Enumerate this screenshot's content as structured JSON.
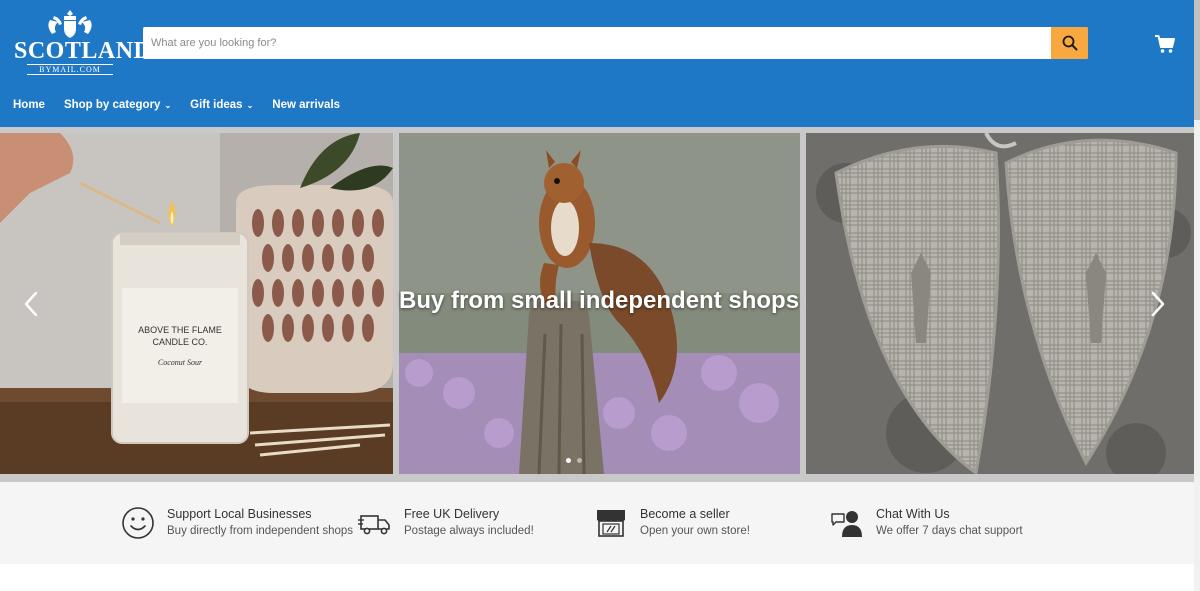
{
  "brand": {
    "name": "SCOTLAND",
    "sub": "BYMAIL.COM"
  },
  "search": {
    "placeholder": "What are you looking for?"
  },
  "icons": {
    "search": "search-icon",
    "cart": "cart-icon"
  },
  "colors": {
    "header": "#1f78c6",
    "search_button": "#f7a83f",
    "features_bg": "#f5f5f5"
  },
  "nav": [
    {
      "label": "Home",
      "has_dropdown": false
    },
    {
      "label": "Shop by category",
      "has_dropdown": true
    },
    {
      "label": "Gift ideas",
      "has_dropdown": true
    },
    {
      "label": "New arrivals",
      "has_dropdown": false
    }
  ],
  "hero": {
    "title": "Buy from small independent shops",
    "slides": 2,
    "active_slide": 1,
    "candle": {
      "brand": "ABOVE THE FLAME",
      "brand2": "CANDLE CO.",
      "scent": "Coconut Sour"
    }
  },
  "features": [
    {
      "icon": "smiley-icon",
      "title": "Support Local Businesses",
      "subtitle": "Buy directly from independent shops"
    },
    {
      "icon": "delivery-truck-icon",
      "title": "Free UK Delivery",
      "subtitle": "Postage always included!"
    },
    {
      "icon": "storefront-icon",
      "title": "Become a seller",
      "subtitle": "Open your own store!"
    },
    {
      "icon": "chat-support-icon",
      "title": "Chat With Us",
      "subtitle": "We offer 7 days chat support"
    }
  ]
}
